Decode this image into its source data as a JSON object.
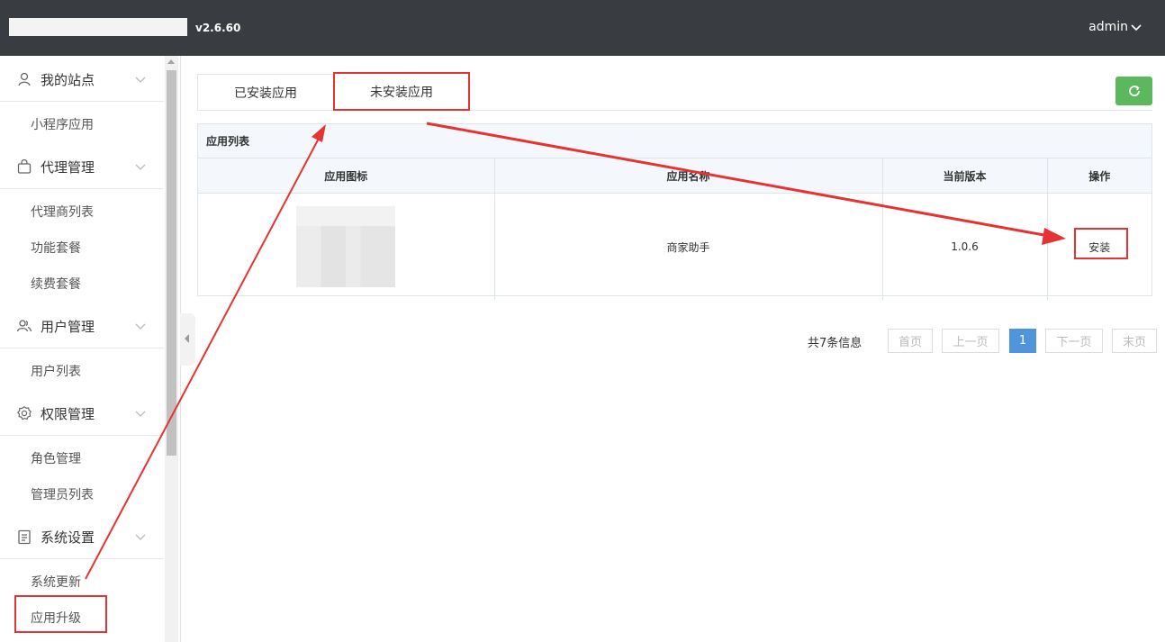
{
  "header": {
    "version": "v2.6.60",
    "user": "admin"
  },
  "sidebar": {
    "groups": [
      {
        "label": "我的站点",
        "icon": "user-icon",
        "items": [
          "小程序应用"
        ]
      },
      {
        "label": "代理管理",
        "icon": "bag-icon",
        "items": [
          "代理商列表",
          "功能套餐",
          "续费套餐"
        ]
      },
      {
        "label": "用户管理",
        "icon": "users-icon",
        "items": [
          "用户列表"
        ]
      },
      {
        "label": "权限管理",
        "icon": "gear-icon",
        "items": [
          "角色管理",
          "管理员列表"
        ]
      },
      {
        "label": "系统设置",
        "icon": "clipboard-icon",
        "items": [
          "系统更新",
          "应用升级"
        ]
      }
    ]
  },
  "tabs": {
    "installed": "已安装应用",
    "uninstalled": "未安装应用"
  },
  "panel": {
    "title": "应用列表",
    "columns": [
      "应用图标",
      "应用名称",
      "当前版本",
      "操作"
    ],
    "rows": [
      {
        "name": "商家助手",
        "version": "1.0.6",
        "action": "安装"
      }
    ]
  },
  "pagination": {
    "info": "共7条信息",
    "first": "首页",
    "prev": "上一页",
    "current": "1",
    "next": "下一页",
    "last": "末页"
  },
  "colors": {
    "topbar": "#393d41",
    "refresh": "#5cb85c",
    "pager_active": "#4f95dc",
    "annotation": "#e53333"
  }
}
